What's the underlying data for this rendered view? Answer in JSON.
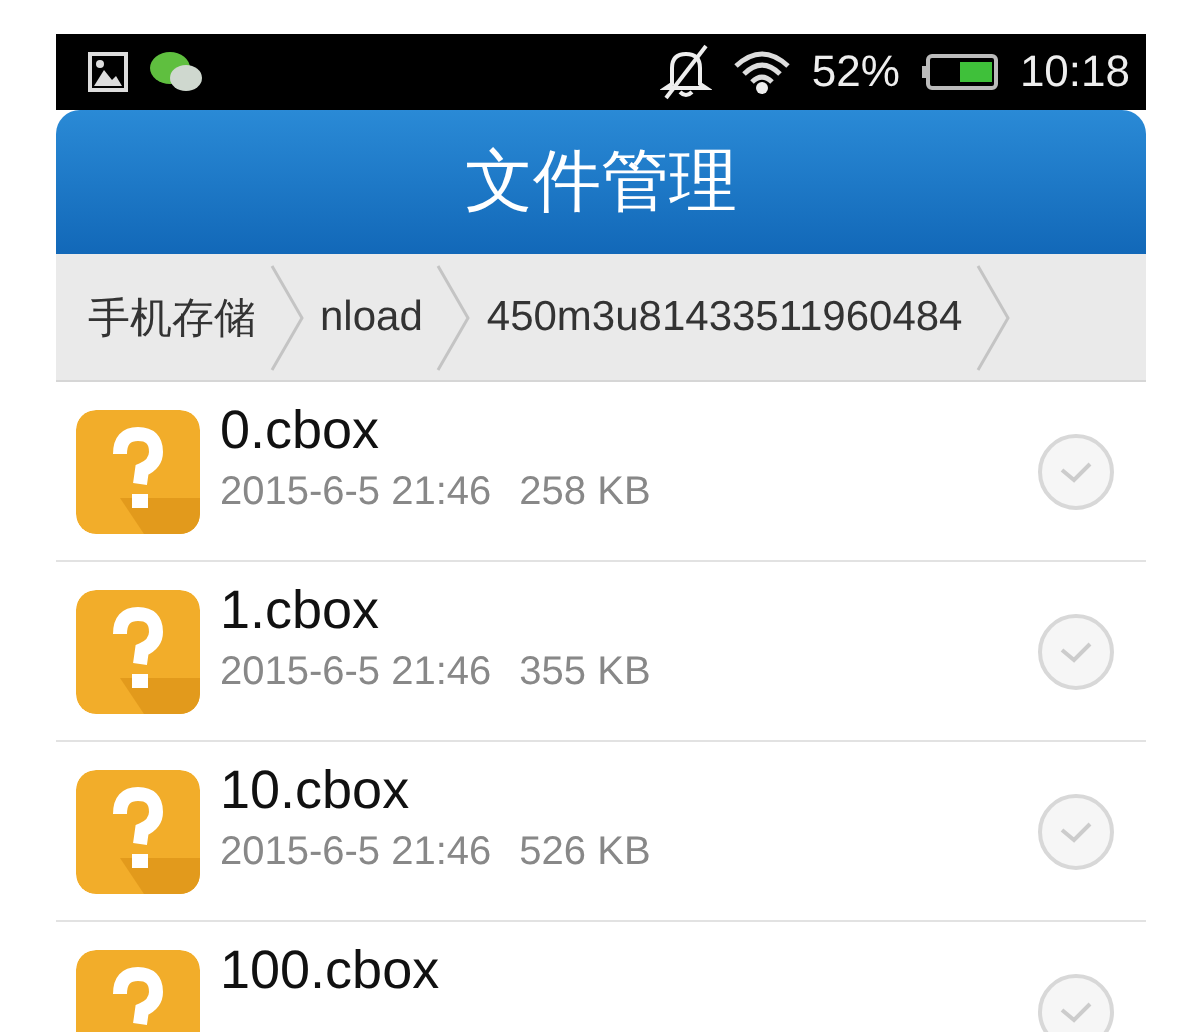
{
  "status_bar": {
    "battery": "52%",
    "time": "10:18"
  },
  "title_bar": {
    "title": "文件管理"
  },
  "breadcrumb": [
    "手机存储",
    "nload",
    "450m3u81433511960484"
  ],
  "files": [
    {
      "name": "0.cbox",
      "date": "2015-6-5 21:46",
      "size": "258 KB",
      "checked": false
    },
    {
      "name": "1.cbox",
      "date": "2015-6-5 21:46",
      "size": "355 KB",
      "checked": false
    },
    {
      "name": "10.cbox",
      "date": "2015-6-5 21:46",
      "size": "526 KB",
      "checked": false
    },
    {
      "name": "100.cbox",
      "checked": false
    }
  ]
}
